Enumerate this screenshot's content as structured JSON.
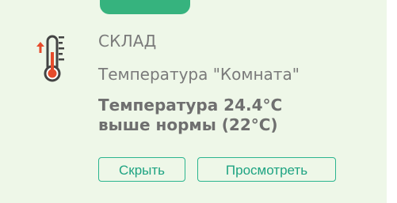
{
  "notification": {
    "category": "СКЛАД",
    "sensor": "Температура \"Комната\"",
    "message_line1": "Температура 24.4°C",
    "message_line2": "выше нормы (22°C)",
    "buttons": {
      "hide": "Скрыть",
      "view": "Просмотреть"
    }
  },
  "colors": {
    "card_bg": "#eef7e8",
    "accent": "#2bb58f",
    "text_muted": "#7a7a7a",
    "alert_red": "#e64b2b",
    "icon_dark": "#444444"
  },
  "icons": {
    "temperature": "thermometer-icon",
    "trend": "arrow-up-icon"
  }
}
